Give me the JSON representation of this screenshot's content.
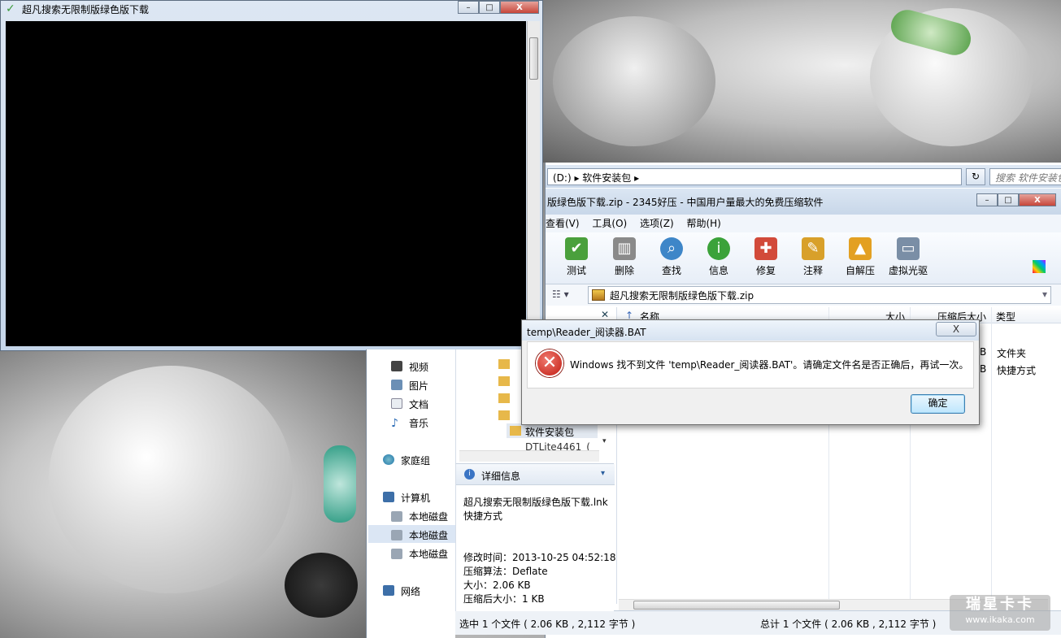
{
  "console": {
    "title": "超凡搜索无限制版绿色版下载",
    "minimize": "–",
    "maximize": "□",
    "close": "X"
  },
  "explorer": {
    "address": "(D:) ▸ 软件安装包 ▸",
    "search_placeholder": "搜索 软件安装包",
    "refresh": "↻"
  },
  "zip_window": {
    "title": "版绿色版下载.zip - 2345好压 - 中国用户量最大的免费压缩软件",
    "menu": [
      "查看(V)",
      "工具(O)",
      "选项(Z)",
      "帮助(H)"
    ],
    "toolbar": [
      {
        "label": "测试",
        "icon": "test-icon",
        "color": "#4aa03c"
      },
      {
        "label": "删除",
        "icon": "delete-icon",
        "color": "#8a8a8a"
      },
      {
        "label": "查找",
        "icon": "find-icon",
        "color": "#3e86c8"
      },
      {
        "label": "信息",
        "icon": "info-icon",
        "color": "#3ba23a"
      },
      {
        "label": "修复",
        "icon": "repair-icon",
        "color": "#d24a3a"
      },
      {
        "label": "注释",
        "icon": "comment-icon",
        "color": "#d8a02a"
      },
      {
        "label": "自解压",
        "icon": "sfx-icon",
        "color": "#e3a022"
      },
      {
        "label": "虚拟光驱",
        "icon": "virtual-drive-icon",
        "color": "#7a8ea6"
      }
    ],
    "path": "超凡搜索无限制版绿色版下载.zip",
    "columns": {
      "name": "名称",
      "size": "大小",
      "packed": "压缩后大小",
      "type": "类型"
    },
    "rows": [
      {
        "size_tail": "B",
        "type": "文件夹"
      },
      {
        "size_tail": "B",
        "type": "快捷方式"
      }
    ],
    "status_left": "选中 1 个文件 ( 2.06 KB , 2,112 字节 )",
    "status_right": "总计 1 个文件 ( 2.06 KB , 2,112 字节 )"
  },
  "nav": {
    "items": [
      "视频",
      "图片",
      "文档",
      "音乐",
      "家庭组",
      "计算机",
      "本地磁盘",
      "本地磁盘",
      "本地磁盘",
      "网络"
    ],
    "tree": [
      "软件安装包",
      "DTLite4461_("
    ]
  },
  "details": {
    "header": "详细信息",
    "file_name": "超凡搜索无限制版绿色版下载.lnk",
    "file_type": "快捷方式",
    "modified": "修改时间：2013-10-25 04:52:18",
    "algorithm": "压缩算法：Deflate",
    "size": "大小：2.06 KB",
    "packed": "压缩后大小：1 KB"
  },
  "dialog": {
    "title": "temp\\Reader_阅读器.BAT",
    "message": "Windows 找不到文件 'temp\\Reader_阅读器.BAT'。请确定文件名是否正确后，再试一次。",
    "ok": "确定",
    "close": "X"
  },
  "watermark": {
    "line1": "瑞星卡卡",
    "line2": "www.ikaka.com"
  }
}
